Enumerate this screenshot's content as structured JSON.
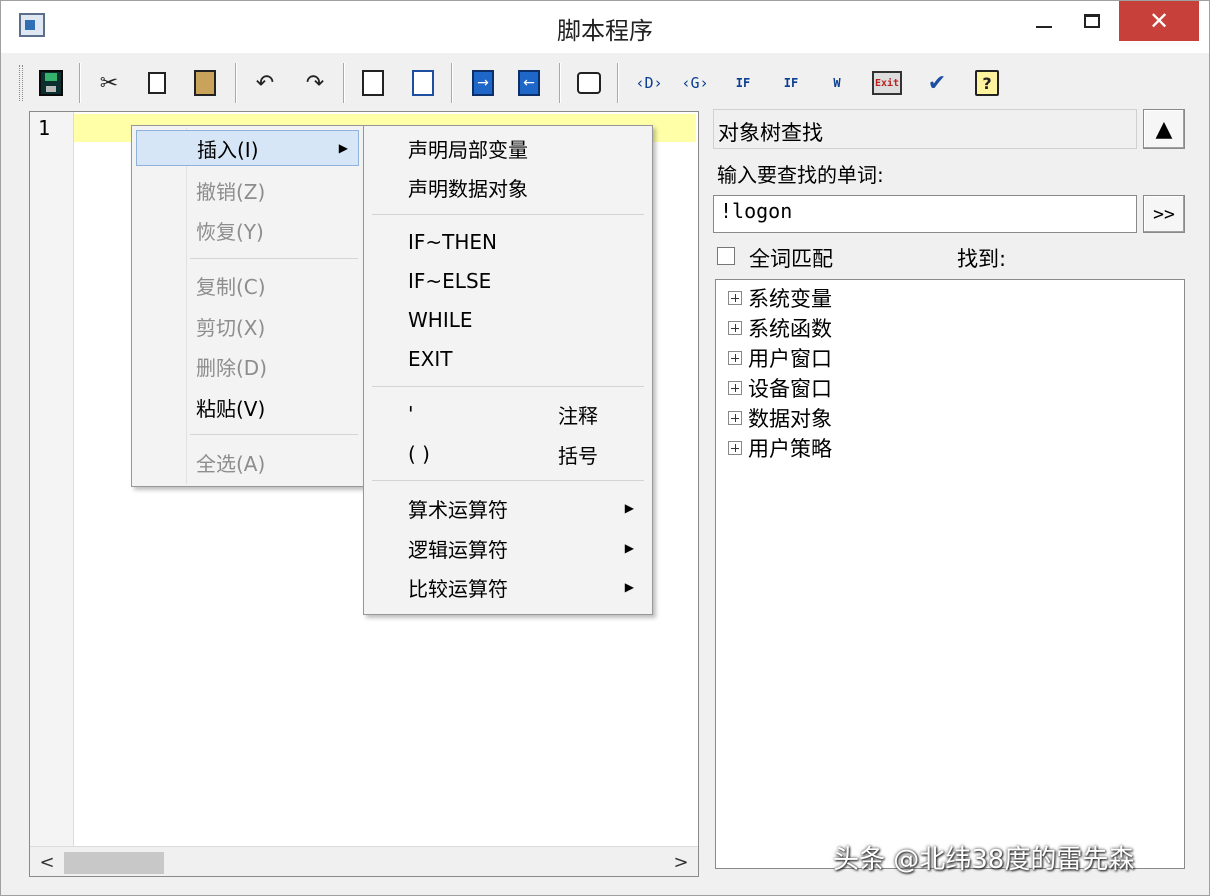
{
  "window": {
    "title": "脚本程序",
    "close_glyph": "✕"
  },
  "toolbar": {
    "cut_glyph": "✂",
    "undo_glyph": "↶",
    "redo_glyph": "↷",
    "insert_d": "‹D›",
    "insert_g": "‹G›",
    "if_then_text": "IF",
    "if_else_text": "IF",
    "exit_text": "Exit",
    "check_glyph": "✔",
    "help_text": "?"
  },
  "editor": {
    "line_number": "1",
    "scroll_left": "<",
    "scroll_right": ">"
  },
  "search_panel": {
    "title": "对象树查找",
    "up_glyph": "▲",
    "label": "输入要查找的单词:",
    "input_value": "!logon",
    "go_label": ">>",
    "match_whole_word": "全词匹配",
    "found_label": "找到:",
    "tree_items": [
      "系统变量",
      "系统函数",
      "用户窗口",
      "设备窗口",
      "数据对象",
      "用户策略"
    ]
  },
  "context_menu": {
    "items": [
      {
        "label": "插入(I)",
        "enabled": true,
        "submenu": true
      },
      {
        "label": "撤销(Z)",
        "enabled": false
      },
      {
        "label": "恢复(Y)",
        "enabled": false
      },
      {
        "label": "复制(C)",
        "enabled": false
      },
      {
        "label": "剪切(X)",
        "enabled": false
      },
      {
        "label": "删除(D)",
        "enabled": false
      },
      {
        "label": "粘贴(V)",
        "enabled": true
      },
      {
        "label": "全选(A)",
        "enabled": false
      }
    ],
    "submenu_arrow": "▶"
  },
  "insert_submenu": {
    "items": [
      {
        "label": "声明局部变量"
      },
      {
        "label": "声明数据对象"
      },
      {
        "label": "IF~THEN"
      },
      {
        "label": "IF~ELSE"
      },
      {
        "label": "WHILE"
      },
      {
        "label": "EXIT"
      },
      {
        "label": "'",
        "right": "注释"
      },
      {
        "label": "( )",
        "right": "括号"
      },
      {
        "label": "算术运算符",
        "submenu": true
      },
      {
        "label": "逻辑运算符",
        "submenu": true
      },
      {
        "label": "比较运算符",
        "submenu": true
      }
    ]
  },
  "watermark": "头条 @北纬38度的雷先森"
}
